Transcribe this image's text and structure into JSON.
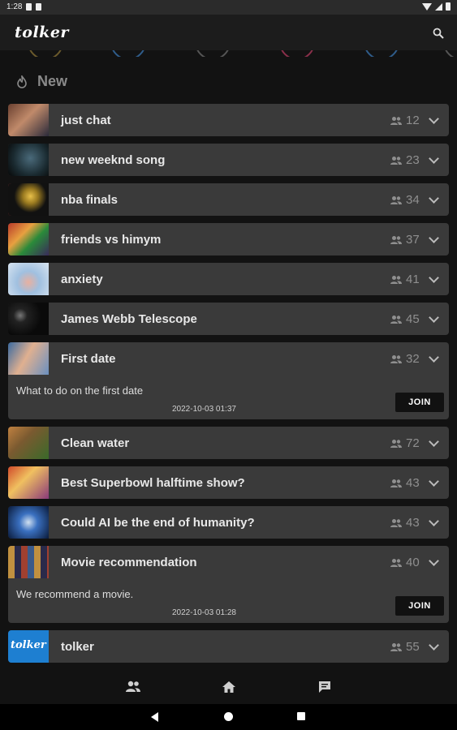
{
  "status": {
    "time": "1:28"
  },
  "app": {
    "logo": "tolker"
  },
  "section": {
    "label": "New"
  },
  "rooms": [
    {
      "title": "just chat",
      "count": "12"
    },
    {
      "title": "new weeknd song",
      "count": "23"
    },
    {
      "title": "nba finals",
      "count": "34"
    },
    {
      "title": "friends vs himym",
      "count": "37"
    },
    {
      "title": "anxiety",
      "count": "41"
    },
    {
      "title": "James Webb Telescope",
      "count": "45"
    },
    {
      "title": "First date",
      "count": "32",
      "description": "What to do on the first date",
      "timestamp": "2022-10-03 01:37",
      "join_label": "JOIN"
    },
    {
      "title": "Clean water",
      "count": "72"
    },
    {
      "title": "Best Superbowl halftime show?",
      "count": "43"
    },
    {
      "title": "Could AI be the end of humanity?",
      "count": "43"
    },
    {
      "title": "Movie recommendation",
      "count": "40",
      "description": "We recommend a movie.",
      "timestamp": "2022-10-03 01:28",
      "join_label": "JOIN"
    },
    {
      "title": "tolker",
      "count": "55",
      "thumb_text": "tolker"
    }
  ],
  "icons": {
    "search": "search-icon",
    "fire": "fire-icon",
    "people": "people-icon",
    "chevron": "chevron-down-icon",
    "nav_people": "people-icon",
    "nav_home": "home-icon",
    "nav_chat": "chat-icon"
  },
  "colors": {
    "background": "#121212",
    "card": "#3a3a3a",
    "join_button": "#111111",
    "tolker_thumb": "#1e7fd1"
  }
}
